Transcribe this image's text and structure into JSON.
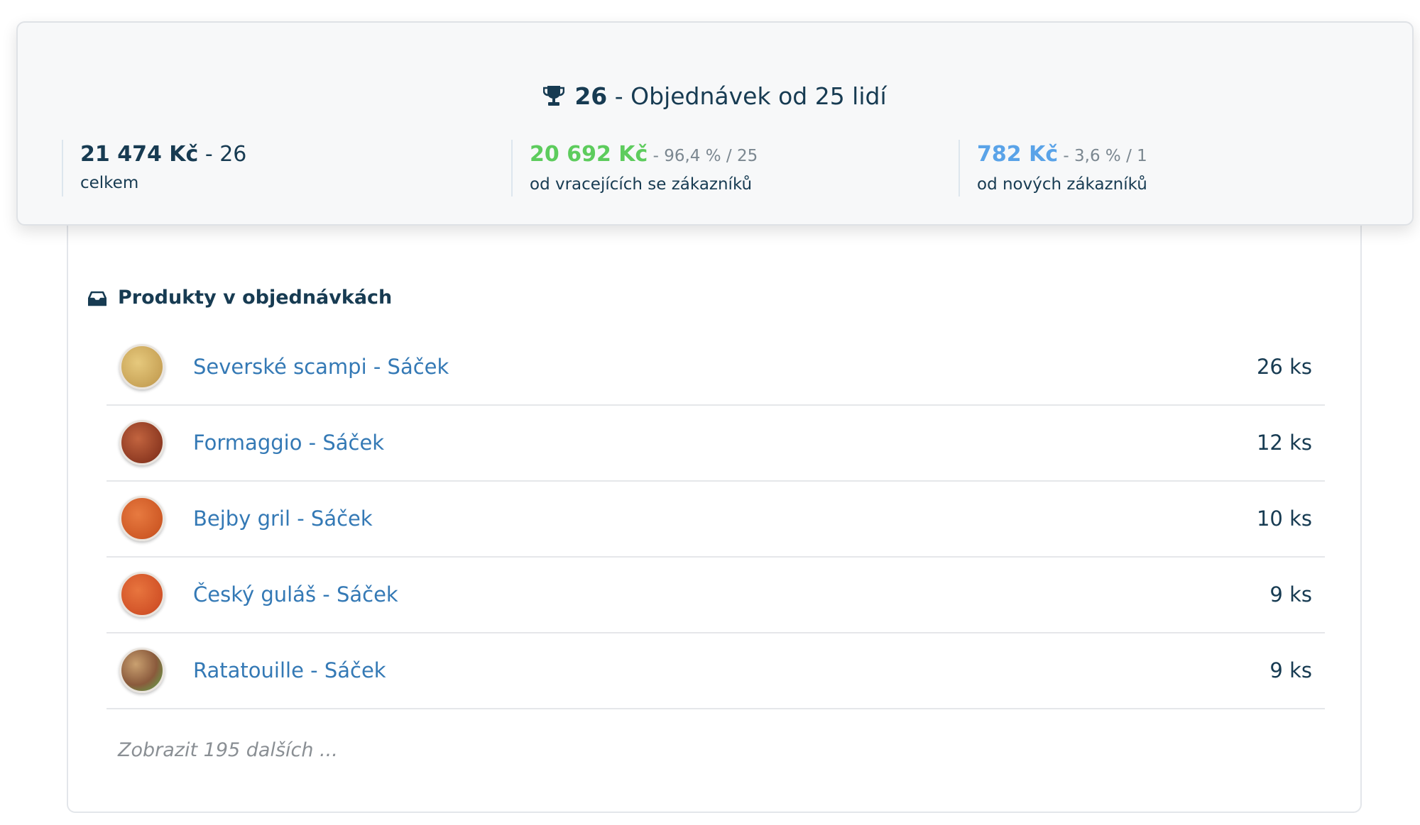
{
  "summary": {
    "count": "26",
    "headline_text": " - Objednávek od 25 lidí",
    "total": {
      "value": "21 474 Kč",
      "detail": " - 26",
      "label": "celkem"
    },
    "returning": {
      "value": "20 692 Kč",
      "detail": " - 96,4 % / 25",
      "label": "od vracejících se zákazníků",
      "color": "#5dcc5d"
    },
    "new": {
      "value": "782 Kč",
      "detail": " - 3,6 % / 1",
      "label": "od nových zákazníků",
      "color": "#5aa3e8"
    }
  },
  "products": {
    "title": "Produkty v objednávkách",
    "items": [
      {
        "name": "Severské scampi - Sáček",
        "qty": "26 ks",
        "thumb_color": "#d9b86a"
      },
      {
        "name": "Formaggio - Sáček",
        "qty": "12 ks",
        "thumb_color": "#a5472e"
      },
      {
        "name": "Bejby gril - Sáček",
        "qty": "10 ks",
        "thumb_color": "#d25a2a"
      },
      {
        "name": "Český guláš - Sáček",
        "qty": "9 ks",
        "thumb_color": "#d6552c"
      },
      {
        "name": "Ratatouille - Sáček",
        "qty": "9 ks",
        "thumb_color": "#8a5a3c"
      }
    ],
    "more_label": "Zobrazit 195 dalších ..."
  },
  "icons": {
    "headline": "trophy-icon",
    "products": "inbox-icon"
  }
}
